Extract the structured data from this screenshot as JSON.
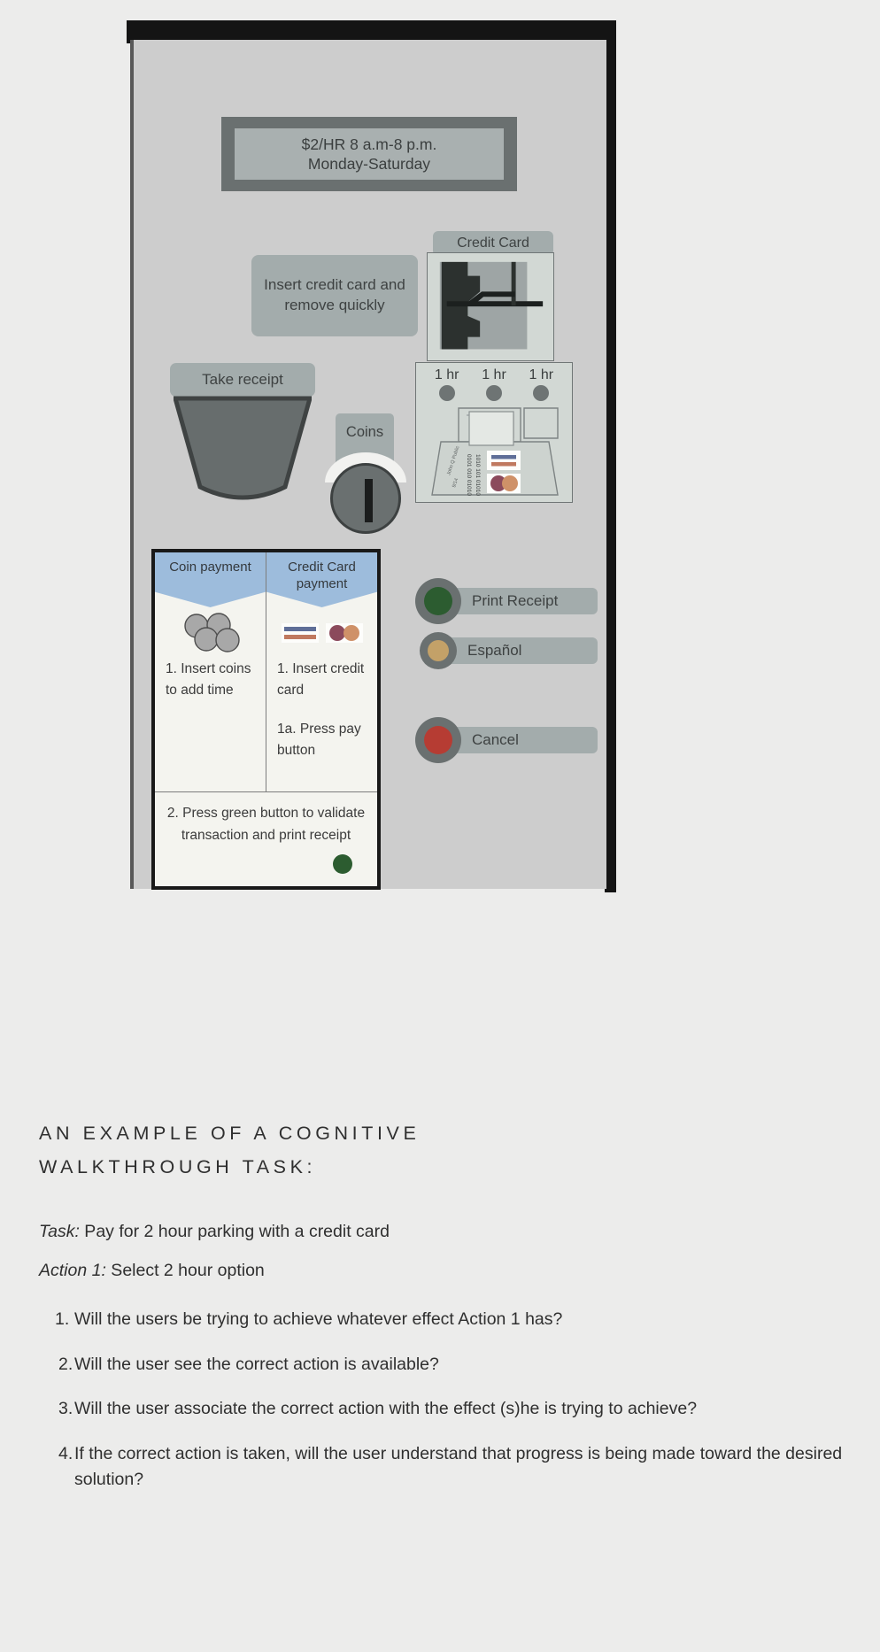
{
  "kiosk": {
    "price_display": {
      "line1": "$2/HR 8 a.m-8 p.m.",
      "line2": "Monday-Saturday"
    },
    "insert_card_label": "Insert credit card and remove quickly",
    "credit_card_title": "Credit Card",
    "take_receipt_label": "Take receipt",
    "coins_label": "Coins",
    "hour_buttons": [
      {
        "label": "1 hr"
      },
      {
        "label": "1 hr"
      },
      {
        "label": "1 hr"
      }
    ],
    "receipt_graphic": {
      "name_on_card": "John Q Public",
      "card_digits_1": "0101 010 01010",
      "card_digits_2": "1010 101 01010",
      "expiry": "9/14"
    },
    "placard": {
      "left_banner": "Coin payment",
      "right_banner": "Credit Card payment",
      "left_steps": "1. Insert coins to add time",
      "right_step_1": "1. Insert credit card",
      "right_step_2": "1a. Press pay button",
      "footer": "2. Press green button to validate transaction and print receipt"
    },
    "buttons": [
      {
        "id": "print-receipt",
        "label": "Print Receipt",
        "color": "#2c5c30"
      },
      {
        "id": "espanol",
        "label": "Español",
        "color": "#c3a168"
      },
      {
        "id": "cancel",
        "label": "Cancel",
        "color": "#b63c33"
      }
    ]
  },
  "caption": {
    "heading": "AN EXAMPLE OF A COGNITIVE WALKTHROUGH TASK:",
    "task_label": "Task:",
    "task_text": " Pay for 2 hour parking with a credit card",
    "action_label": "Action 1:",
    "action_text": " Select 2 hour option",
    "questions": [
      {
        "num": "1.",
        "text": "Will the users be trying to achieve whatever effect Action 1 has?"
      },
      {
        "num": "2.",
        "text": "Will the user see the correct action is available?"
      },
      {
        "num": "3.",
        "text": "Will the user associate the correct action with the effect (s)he is trying to achieve?"
      },
      {
        "num": "4.",
        "text": "If the correct action is taken, will the user understand that progress is being made toward the desired solution?"
      }
    ]
  },
  "colors": {
    "page_background": "#ececeb",
    "kiosk_face": "#cdcdcd",
    "kiosk_edge": "#141414",
    "label_pill": "#a3acac",
    "display_bezel": "#6a7070",
    "banner_blue": "#9dbcdc",
    "green_button": "#2c5c30",
    "gold_button": "#c3a168",
    "red_button": "#b63c33"
  }
}
